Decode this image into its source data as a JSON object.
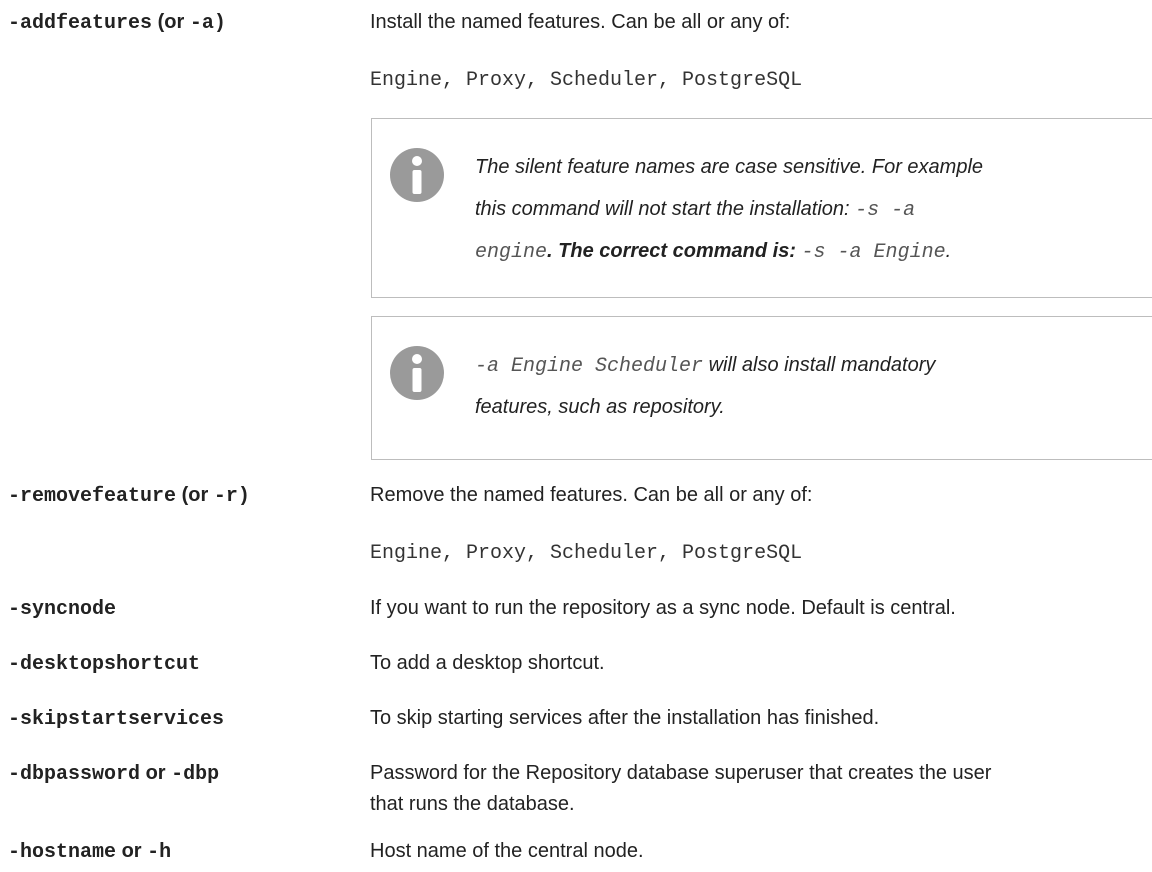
{
  "rows": [
    {
      "param": {
        "flag1": "-addfeatures",
        "or": "(or",
        "flag2": "-a)"
      },
      "desc": "Install the named features. Can be all or any of:",
      "code": "Engine, Proxy, Scheduler, PostgreSQL"
    },
    {
      "param": {
        "flag1": "-removefeature",
        "or": "(or",
        "flag2": "-r)"
      },
      "desc": "Remove the named features. Can be all or any of:",
      "code": "Engine, Proxy, Scheduler, PostgreSQL"
    },
    {
      "param": {
        "flag1": "-syncnode"
      },
      "desc": "If you want to run the repository as a sync node. Default is central."
    },
    {
      "param": {
        "flag1": "-desktopshortcut"
      },
      "desc": "To add a desktop shortcut."
    },
    {
      "param": {
        "flag1": "-skipstartservices"
      },
      "desc": "To skip starting services after the installation has finished."
    },
    {
      "param": {
        "flag1": "-dbpassword",
        "or": "or",
        "flag2": "-dbp"
      },
      "desc_lines": [
        "Password for the Repository database superuser that creates the user",
        "that runs the database."
      ]
    },
    {
      "param": {
        "flag1": "-hostname",
        "or": "or",
        "flag2": "-h"
      },
      "desc": "Host name of the central node."
    }
  ],
  "notes": [
    {
      "icon": "info-icon",
      "line1": "The silent feature names are case sensitive. For example",
      "line2_text": "this command will not start the installation:",
      "line2_code": "-s -a",
      "line3_code1": "engine",
      "line3_text": ". The correct command is:",
      "line3_code2": "-s -a Engine",
      "line3_end": "."
    },
    {
      "icon": "info-icon",
      "line1_code": "-a Engine Scheduler",
      "line1_text": " will also install mandatory",
      "line2": "features, such as repository."
    }
  ],
  "colors": {
    "icon_fill": "#9a9a9a",
    "border": "#bdbdbd",
    "text": "#222222"
  }
}
